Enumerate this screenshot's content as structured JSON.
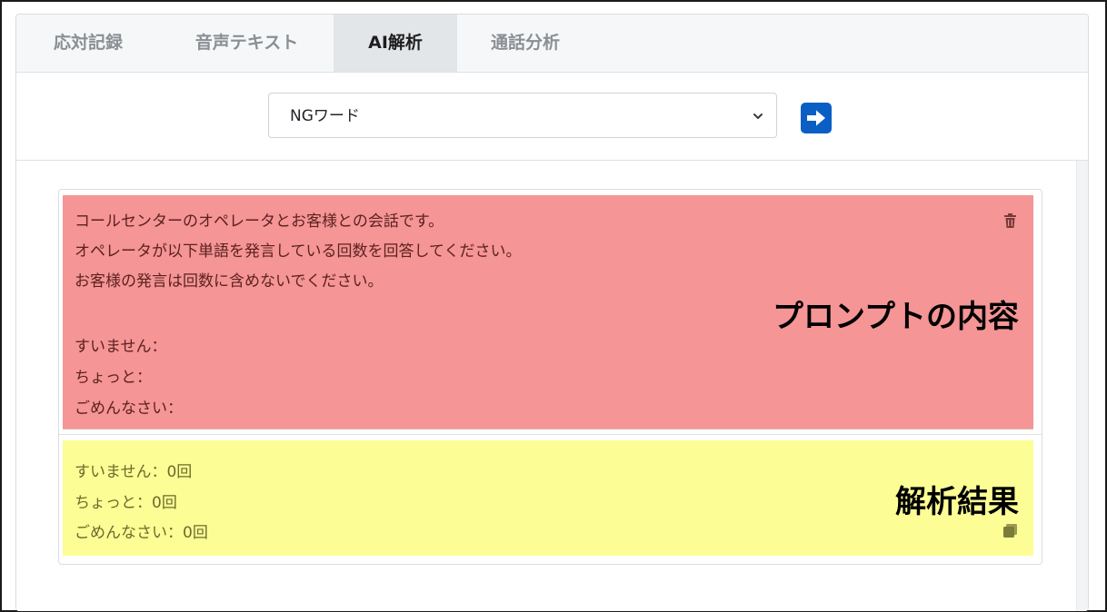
{
  "tabs": [
    {
      "label": "応対記録",
      "active": false
    },
    {
      "label": "音声テキスト",
      "active": false
    },
    {
      "label": "AI解析",
      "active": true
    },
    {
      "label": "通話分析",
      "active": false
    }
  ],
  "toolbar": {
    "selected_prompt": "NGワード",
    "run_icon": "arrow-right-icon"
  },
  "prompt": {
    "lines": [
      "コールセンターのオペレータとお客様との会話です。",
      "オペレータが以下単語を発言している回数を回答してください。",
      "お客様の発言は回数に含めないでください。",
      "",
      "すいません：",
      "ちょっと：",
      "ごめんなさい："
    ],
    "annotation": "プロンプトの内容",
    "delete_icon": "trash-icon",
    "color": "#f59595"
  },
  "result": {
    "lines": [
      "すいません：0回",
      "ちょっと：0回",
      "ごめんなさい：0回"
    ],
    "annotation": "解析結果",
    "copy_icon": "copy-icon",
    "color": "#fdfd95"
  }
}
